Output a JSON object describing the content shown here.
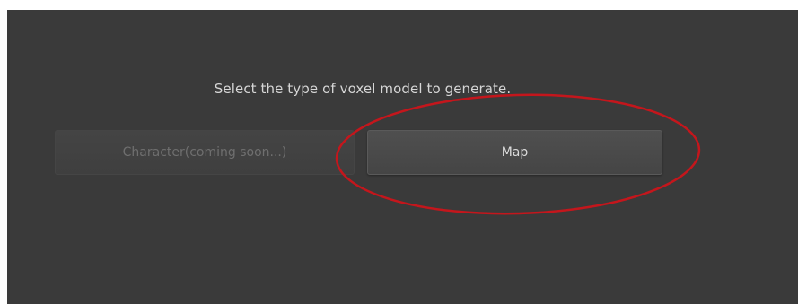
{
  "dialog": {
    "prompt": "Select the type of voxel model to generate.",
    "buttons": {
      "character_label": "Character(coming soon...)",
      "character_enabled": false,
      "map_label": "Map",
      "map_enabled": true
    }
  },
  "colors": {
    "panel_background": "#3a3a3a",
    "annotation_ellipse": "#c4161c"
  }
}
